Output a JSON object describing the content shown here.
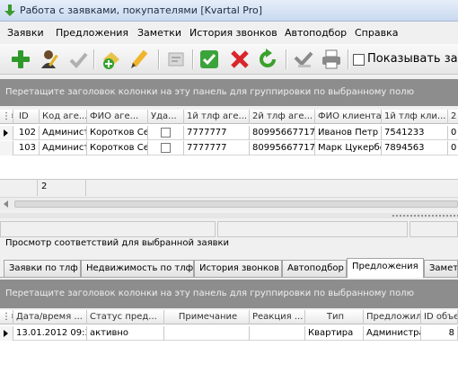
{
  "window": {
    "title": "Работа с заявками, покупателями [Kvartal Pro]"
  },
  "menu": [
    "Заявки",
    "Предложения",
    "Заметки",
    "История звонков",
    "Автоподбор",
    "Справка"
  ],
  "toolbar": {
    "icons": [
      "add-icon",
      "user-edit-icon",
      "check-user-icon",
      "add-document-icon",
      "pencil-icon",
      "card-icon",
      "approve-icon",
      "delete-icon",
      "refresh-icon",
      "export-icon",
      "print-icon"
    ],
    "show_checkbox_label": "Показывать зав"
  },
  "group_panel_text": "Перетащите заголовок колонки на эту панель для группировки по выбранному полю",
  "requests_table": {
    "columns": [
      "ID",
      "Код аге...",
      "ФИО аге...",
      "Уда...",
      "1й тлф аге...",
      "2й тлф аге...",
      "ФИО клиента",
      "1й тлф кли...",
      "2"
    ],
    "rows": [
      {
        "id": "102",
        "agent_code": "Администр",
        "agent_name": "Коротков Се",
        "deleted": false,
        "agent_phone1": "7777777",
        "agent_phone2": "80995667717",
        "client_name": "Иванов Петр",
        "client_phone1": "7541233",
        "client_phone2": "0"
      },
      {
        "id": "103",
        "agent_code": "Администр",
        "agent_name": "Коротков Се",
        "deleted": false,
        "agent_phone1": "7777777",
        "agent_phone2": "80995667717",
        "client_name": "Марк Цукербе",
        "client_phone1": "7894563",
        "client_phone2": "0"
      }
    ],
    "row_count": "2"
  },
  "matches_label": "Просмотр соответствий для выбранной заявки",
  "tabs": [
    "Заявки по тлф",
    "Недвижимость по тлф",
    "История звонков",
    "Автоподбор",
    "Предложения",
    "Заметк"
  ],
  "active_tab": "Предложения",
  "offers_table": {
    "columns": [
      "Дата/время ...",
      "Статус пред...",
      "Примечание",
      "Реакция ...",
      "Тип",
      "Предложил",
      "ID объе"
    ],
    "rows": [
      {
        "datetime": "13.01.2012 09:3",
        "status": "активно",
        "note": "",
        "reaction": "",
        "type": "Квартира",
        "offered_by": "Администра",
        "object_id": "8"
      }
    ]
  },
  "colors": {
    "group_panel": "#8d8d8d",
    "title_gradient_top": "#e6eef9",
    "title_gradient_bottom": "#c9d9ef"
  }
}
